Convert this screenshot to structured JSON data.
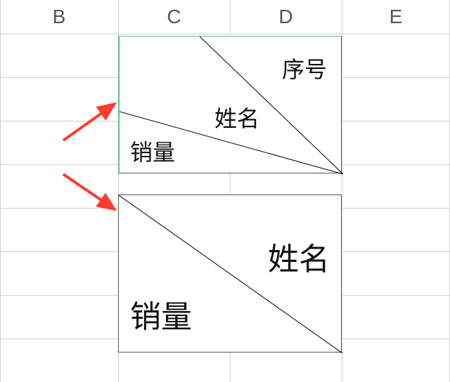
{
  "columns": {
    "b": "B",
    "c": "C",
    "d": "D",
    "e": "E"
  },
  "box1": {
    "seq": "序号",
    "name": "姓名",
    "sales": "销量"
  },
  "box2": {
    "name": "姓名",
    "sales": "销量"
  }
}
